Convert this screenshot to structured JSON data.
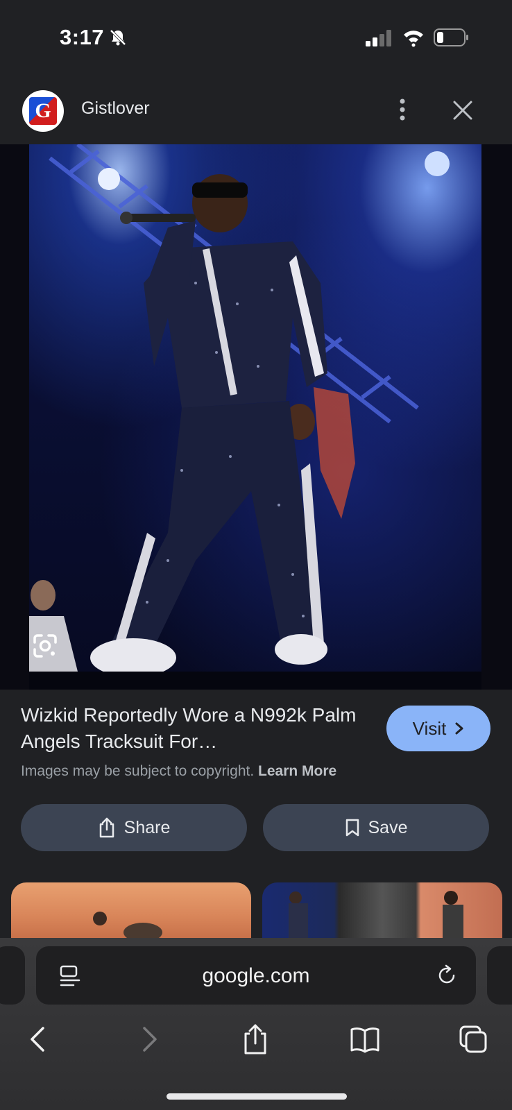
{
  "status_bar": {
    "time": "3:17",
    "icons": [
      "bell-slash-icon",
      "cellular-signal-icon",
      "wifi-icon",
      "battery-icon"
    ]
  },
  "header": {
    "site_logo_letter": "G",
    "site_name": "Gistlover",
    "menu_icon": "more-vert-icon",
    "close_icon": "close-icon"
  },
  "image": {
    "lens_icon": "google-lens-icon"
  },
  "result": {
    "title": "Wizkid Reportedly Wore a N992k Palm Angels Tracksuit For…",
    "visit_label": "Visit",
    "copyright_text": "Images may be subject to copyright.",
    "learn_more_label": "Learn More"
  },
  "actions": {
    "share_label": "Share",
    "save_label": "Save"
  },
  "browser": {
    "url": "google.com",
    "nav_icons": [
      "back-icon",
      "forward-icon",
      "share-icon",
      "bookmarks-icon",
      "tabs-icon"
    ]
  },
  "colors": {
    "background": "#202124",
    "accent": "#8ab4f8",
    "button_bg": "#3c4453"
  }
}
